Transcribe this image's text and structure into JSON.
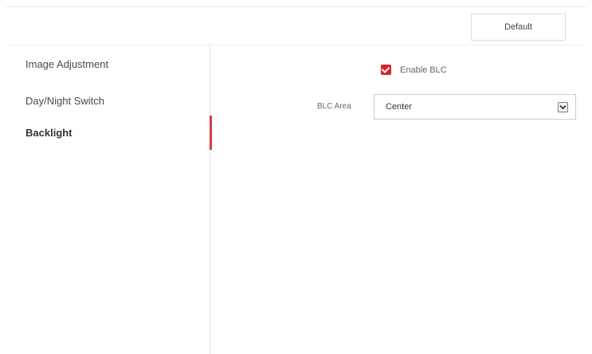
{
  "toolbar": {
    "default_label": "Default"
  },
  "sidebar": {
    "items": [
      {
        "label": "Image Adjustment",
        "active": false
      },
      {
        "label": "Day/Night Switch",
        "active": false
      },
      {
        "label": "Backlight",
        "active": true
      }
    ]
  },
  "backlight": {
    "enable_blc_label": "Enable BLC",
    "enable_blc_checked": true,
    "blc_area_label": "BLC Area",
    "blc_area_value": "Center"
  },
  "colors": {
    "accent": "#d8262e",
    "active_indicator": "#cf3f4a"
  },
  "icons": {
    "checkbox": "checkbox-checked-icon",
    "dropdown": "chevron-down-icon"
  }
}
